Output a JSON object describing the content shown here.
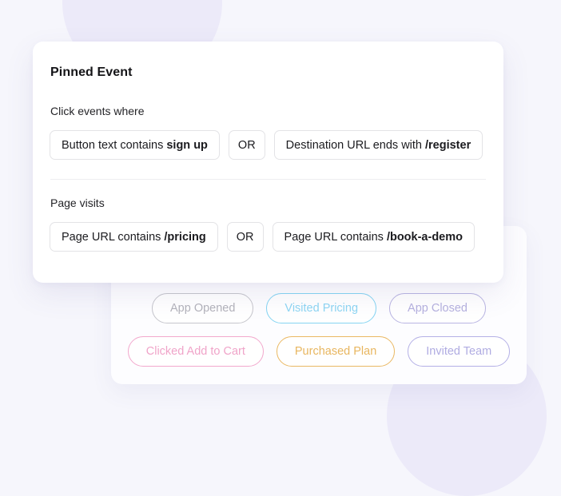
{
  "card": {
    "title": "Pinned Event",
    "sections": [
      {
        "label": "Click events where",
        "conditions": [
          {
            "prefix": "Button text contains",
            "value": "sign up"
          },
          {
            "prefix": "Destination URL ends with",
            "value": "/register"
          }
        ],
        "operator": "OR"
      },
      {
        "label": "Page visits",
        "conditions": [
          {
            "prefix": "Page URL contains",
            "value": "/pricing"
          },
          {
            "prefix": "Page URL contains",
            "value": "/book-a-demo"
          }
        ],
        "operator": "OR"
      }
    ]
  },
  "event_chips": {
    "rows": [
      [
        {
          "label": "App Opened",
          "color": "#c6c6cc",
          "text_color": "#b3b3bb"
        },
        {
          "label": "Visited Pricing",
          "color": "#85d4f2",
          "text_color": "#8ed6f3"
        },
        {
          "label": "App Closed",
          "color": "#b9b5e2",
          "text_color": "#b5b1df"
        }
      ],
      [
        {
          "label": "Clicked Add to Cart",
          "color": "#f2a8cd",
          "text_color": "#f0a4c9"
        },
        {
          "label": "Purchased Plan",
          "color": "#eab863",
          "text_color": "#e8b65f"
        },
        {
          "label": "Invited Team",
          "color": "#b4b0e6",
          "text_color": "#b0ace2"
        }
      ]
    ]
  },
  "theme": {
    "page_background": "#f6f6fc",
    "blob_color": "#eceaf9",
    "card_background": "#ffffff",
    "border_color": "#e3e3e6",
    "divider_color": "#ededf0",
    "title_color": "#141417"
  }
}
